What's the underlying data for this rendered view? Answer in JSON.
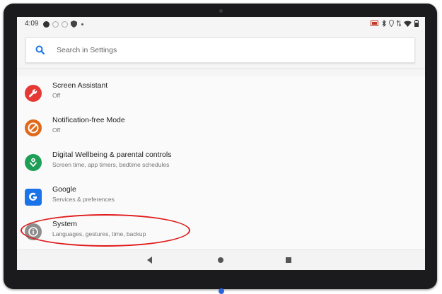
{
  "status_bar": {
    "time": "4:09",
    "left_icons": [
      "circle-icon",
      "settings-hollow-icon",
      "settings-hollow-icon",
      "shield-icon",
      "small-dot-icon"
    ],
    "right_icons": [
      "battery-saver-icon",
      "bluetooth-icon",
      "location-icon",
      "data-arrows-icon",
      "wifi-icon",
      "battery-icon"
    ]
  },
  "search": {
    "placeholder": "Search in Settings",
    "icon": "search-icon"
  },
  "settings_items": [
    {
      "title": "Screen Assistant",
      "subtitle": "Off",
      "icon": "wrench-icon",
      "color": "#e53935"
    },
    {
      "title": "Notification-free Mode",
      "subtitle": "Off",
      "icon": "no-entry-icon",
      "color": "#e06a1b"
    },
    {
      "title": "Digital Wellbeing & parental controls",
      "subtitle": "Screen time, app timers, bedtime schedules",
      "icon": "heart-person-icon",
      "color": "#1e9e57"
    },
    {
      "title": "Google",
      "subtitle": "Services & preferences",
      "icon": "google-g-icon",
      "color": "#1a73e8"
    },
    {
      "title": "System",
      "subtitle": "Languages, gestures, time, backup",
      "icon": "info-icon",
      "color": "#8e8e8e"
    }
  ],
  "nav_bar": {
    "buttons": [
      "back-icon",
      "home-icon",
      "recents-icon"
    ]
  },
  "annotation": {
    "highlight_color": "#e01b1b",
    "highlighted_item": "System"
  }
}
